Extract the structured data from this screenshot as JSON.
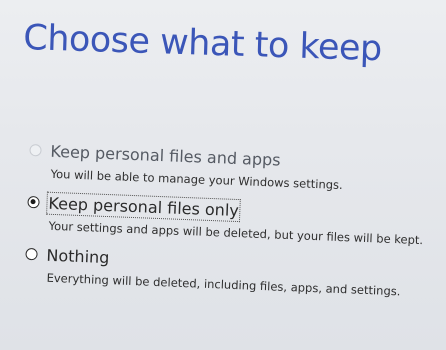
{
  "page": {
    "title": "Choose what to keep"
  },
  "options": [
    {
      "label": "Keep personal files and apps",
      "description": "You will be able to manage your Windows settings.",
      "selected": false,
      "enabled": false
    },
    {
      "label": "Keep personal files only",
      "description": "Your settings and apps will be deleted, but your files will be kept.",
      "selected": true,
      "enabled": true
    },
    {
      "label": "Nothing",
      "description": "Everything will be deleted, including files, apps, and settings.",
      "selected": false,
      "enabled": true
    }
  ],
  "colors": {
    "title": "#3b56b8",
    "background": "#e6e8ec",
    "text": "#2a2a2a"
  }
}
